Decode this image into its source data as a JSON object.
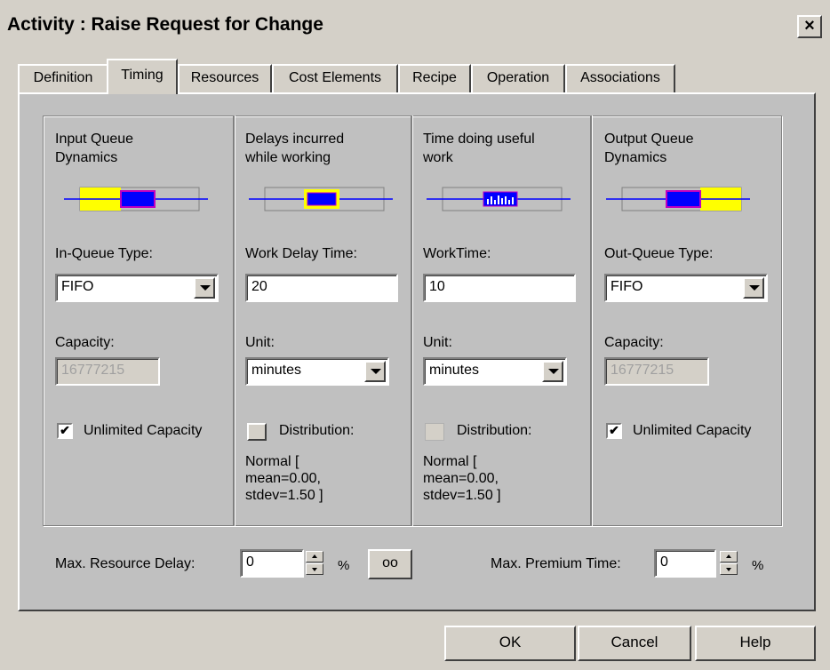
{
  "window": {
    "title": "Activity : Raise Request for Change",
    "close_label": "×"
  },
  "tabs": [
    {
      "label": "Definition",
      "active": false
    },
    {
      "label": "Timing",
      "active": true
    },
    {
      "label": "Resources",
      "active": false
    },
    {
      "label": "Cost Elements",
      "active": false
    },
    {
      "label": "Recipe",
      "active": false
    },
    {
      "label": "Operation",
      "active": false
    },
    {
      "label": "Associations",
      "active": false
    }
  ],
  "input_queue": {
    "heading": "Input Queue\nDynamics",
    "type_label": "In-Queue Type:",
    "type_value": "FIFO",
    "capacity_label": "Capacity:",
    "capacity_value": "16777215",
    "unlimited_label": "Unlimited Capacity",
    "unlimited_checked": true
  },
  "delays": {
    "heading": "Delays incurred\nwhile working",
    "time_label": "Work Delay Time:",
    "time_value": "20",
    "unit_label": "Unit:",
    "unit_value": "minutes",
    "distribution_label": "Distribution:",
    "distribution_text": "Normal [\nmean=0.00,\nstdev=1.50 ]"
  },
  "work": {
    "heading": "Time doing useful\nwork",
    "time_label": "WorkTime:",
    "time_value": "10",
    "unit_label": "Unit:",
    "unit_value": "minutes",
    "distribution_label": "Distribution:",
    "distribution_text": "Normal [\nmean=0.00,\nstdev=1.50 ]"
  },
  "output_queue": {
    "heading": "Output Queue\nDynamics",
    "type_label": "Out-Queue Type:",
    "type_value": "FIFO",
    "capacity_label": "Capacity:",
    "capacity_value": "16777215",
    "unlimited_label": "Unlimited Capacity",
    "unlimited_checked": true
  },
  "bottom": {
    "max_resource_delay_label": "Max. Resource Delay:",
    "max_resource_delay_value": "0",
    "percent_1": "%",
    "infinity_label": "oo",
    "max_premium_time_label": "Max. Premium Time:",
    "max_premium_time_value": "0",
    "percent_2": "%"
  },
  "buttons": {
    "ok": "OK",
    "cancel": "Cancel",
    "help": "Help"
  },
  "colors": {
    "queue_fill": "#ffff00",
    "block_fill": "#0000ff",
    "block_border": "#c000c0",
    "line": "#0000ff"
  },
  "check_mark": "✔"
}
